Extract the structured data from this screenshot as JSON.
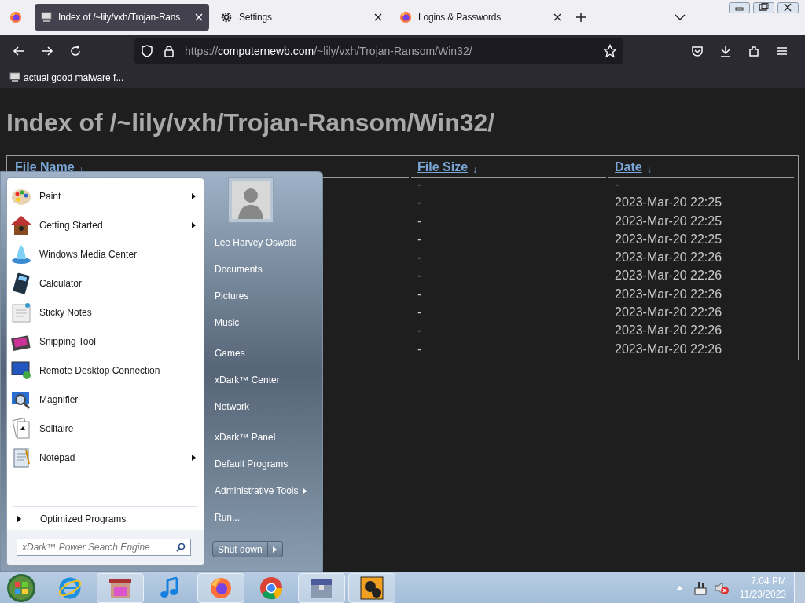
{
  "browser": {
    "tabs": [
      {
        "title": "Index of /~lily/vxh/Trojan-Rans",
        "selected": true
      },
      {
        "title": "Settings",
        "selected": false
      },
      {
        "title": "Logins & Passwords",
        "selected": false
      }
    ],
    "url_prefix": "https://",
    "url_domain": "computernewb.com",
    "url_path": "/~lily/vxh/Trojan-Ransom/Win32/",
    "bookmarks": [
      "actual good malware f..."
    ]
  },
  "page": {
    "heading": "Index of /~lily/vxh/Trojan-Ransom/Win32/",
    "columns": [
      {
        "label": "File Name",
        "sort": "↓"
      },
      {
        "label": "File Size",
        "sort": "↓"
      },
      {
        "label": "Date",
        "sort": "↓"
      }
    ],
    "rows": [
      {
        "size": "-",
        "date": "-"
      },
      {
        "size": "-",
        "date": "2023-Mar-20 22:25"
      },
      {
        "size": "-",
        "date": "2023-Mar-20 22:25"
      },
      {
        "size": "-",
        "date": "2023-Mar-20 22:25"
      },
      {
        "size": "-",
        "date": "2023-Mar-20 22:26"
      },
      {
        "size": "-",
        "date": "2023-Mar-20 22:26"
      },
      {
        "size": "-",
        "date": "2023-Mar-20 22:26"
      },
      {
        "size": "-",
        "date": "2023-Mar-20 22:26"
      },
      {
        "size": "-",
        "date": "2023-Mar-20 22:26"
      },
      {
        "size": "-",
        "date": "2023-Mar-20 22:26"
      }
    ]
  },
  "start_menu": {
    "programs": [
      {
        "label": "Paint",
        "submenu": true
      },
      {
        "label": "Getting Started",
        "submenu": true
      },
      {
        "label": "Windows Media Center",
        "submenu": false
      },
      {
        "label": "Calculator",
        "submenu": false
      },
      {
        "label": "Sticky Notes",
        "submenu": false
      },
      {
        "label": "Snipping Tool",
        "submenu": false
      },
      {
        "label": "Remote Desktop Connection",
        "submenu": false
      },
      {
        "label": "Magnifier",
        "submenu": false
      },
      {
        "label": "Solitaire",
        "submenu": false
      },
      {
        "label": "Notepad",
        "submenu": true
      }
    ],
    "all_programs": "Optimized Programs",
    "search": {
      "placeholder": "xDark™ Power Search Engine"
    },
    "right_groups": [
      [
        {
          "label": "Lee Harvey Oswald",
          "submenu": false
        },
        {
          "label": "Documents",
          "submenu": false
        },
        {
          "label": "Pictures",
          "submenu": false
        },
        {
          "label": "Music",
          "submenu": false
        }
      ],
      [
        {
          "label": "Games",
          "submenu": false
        },
        {
          "label": "xDark™ Center",
          "submenu": false
        },
        {
          "label": "Network",
          "submenu": false
        }
      ],
      [
        {
          "label": "xDark™ Panel",
          "submenu": false
        },
        {
          "label": "Default Programs",
          "submenu": false
        },
        {
          "label": "Administrative Tools",
          "submenu": true
        },
        {
          "label": "Run...",
          "submenu": false
        }
      ]
    ],
    "shutdown": "Shut down"
  },
  "taskbar": {
    "time": "7:04 PM",
    "date": "11/23/2023"
  }
}
